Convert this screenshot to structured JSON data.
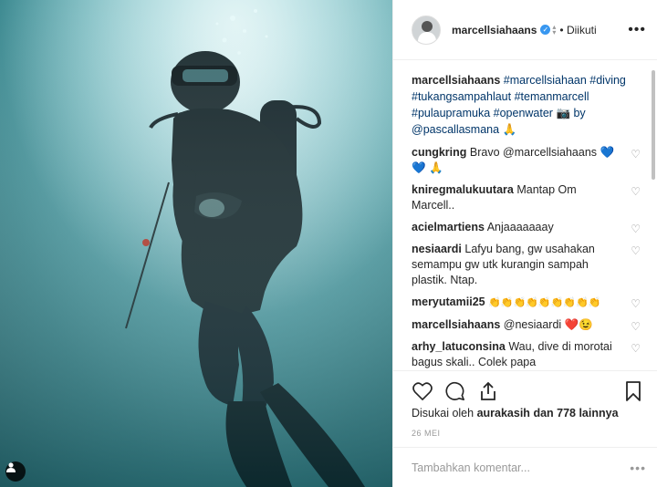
{
  "post": {
    "image_alt": "Scuba diver underwater",
    "author": "marcellsiahaans",
    "follow_status": "Diikuti",
    "caption_user": "marcellsiahaans",
    "caption_text": "#marcellsiahaan #diving #tukangsampahlaut #temanmarcell #pulaupramuka #openwater 📷 by @pascallasmana 🙏",
    "comments": [
      {
        "user": "cungkring",
        "text": "Bravo @marcellsiahaans 💙 💙 🙏"
      },
      {
        "user": "kniregmalukuutara",
        "text": "Mantap Om Marcell.."
      },
      {
        "user": "acielmartiens",
        "text": "Anjaaaaaaay"
      },
      {
        "user": "nesiaardi",
        "text": "Lafyu bang, gw usahakan semampu gw utk kurangin sampah plastik. Ntap."
      },
      {
        "user": "meryutamii25",
        "text": "👏👏👏👏👏👏👏👏👏"
      },
      {
        "user": "marcellsiahaans",
        "text": "@nesiaardi ❤️😉"
      },
      {
        "user": "arhy_latuconsina",
        "text": "Wau, dive di morotai bagus skali.. Colek papa @iskandar_latuconsina ajak dlu mas @marcellsiahaans Ke morotai sama Mba @rimamelati"
      }
    ],
    "likes_text": "Disukai oleh",
    "likes_user": "aurakasih",
    "likes_rest": "dan 778 lainnya",
    "date": "26 MEI",
    "comment_placeholder": "Tambahkan komentar...",
    "more_dots": "•••"
  },
  "colors": {
    "water_top": "#bfe5ea",
    "water_bottom": "#2c6f76",
    "verified": "#3897f0",
    "heart_red": "#ed4956"
  },
  "icons": [
    "tag-user-icon",
    "verified-icon",
    "heart-icon",
    "comment-icon",
    "share-icon",
    "bookmark-icon",
    "more-options-icon"
  ]
}
